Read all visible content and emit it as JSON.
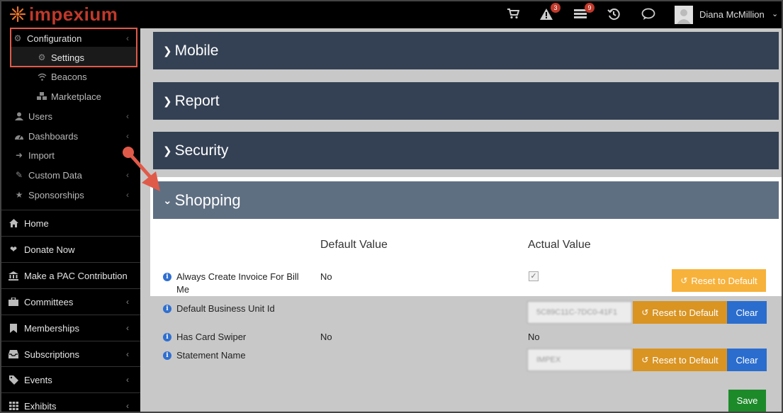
{
  "app": {
    "logo_text": "impexium",
    "brand_color": "#c0392b"
  },
  "topbar": {
    "cart_icon": "cart-icon",
    "alerts_badge": "3",
    "tasks_badge": "9",
    "history_icon": "history-icon",
    "chat_icon": "chat-icon",
    "user_name": "Diana McMillion"
  },
  "sidebar": {
    "configuration": "Configuration",
    "settings": "Settings",
    "beacons": "Beacons",
    "marketplace": "Marketplace",
    "users": "Users",
    "dashboards": "Dashboards",
    "import": "Import",
    "custom_data": "Custom Data",
    "sponsorships": "Sponsorships",
    "main": [
      {
        "label": "Home",
        "icon": "home-icon"
      },
      {
        "label": "Donate Now",
        "icon": "heart-icon"
      },
      {
        "label": "Make a PAC Contribution",
        "icon": "bank-icon"
      },
      {
        "label": "Committees",
        "icon": "briefcase-icon"
      },
      {
        "label": "Memberships",
        "icon": "bookmark-icon"
      },
      {
        "label": "Subscriptions",
        "icon": "inbox-icon"
      },
      {
        "label": "Events",
        "icon": "tag-icon"
      },
      {
        "label": "Exhibits",
        "icon": "grid-icon"
      }
    ]
  },
  "panels": {
    "mobile": "Mobile",
    "report": "Report",
    "security": "Security",
    "shopping": "Shopping"
  },
  "shopping": {
    "col_default": "Default Value",
    "col_actual": "Actual Value",
    "rows": [
      {
        "label": "Always Create Invoice For Bill Me",
        "default": "No",
        "actual_checked": true,
        "reset": "Reset to Default"
      },
      {
        "label": "Default Business Unit Id",
        "default": "",
        "actual_value": "5C89C11C-7DC0-41F1",
        "reset": "Reset to Default",
        "clear": "Clear"
      },
      {
        "label": "Has Card Swiper",
        "default": "No",
        "actual": "No"
      },
      {
        "label": "Statement Name",
        "default": "",
        "actual_value": "IMPEX",
        "reset": "Reset to Default",
        "clear": "Clear"
      }
    ],
    "save": "Save"
  },
  "colors": {
    "panel_dark": "#344154",
    "panel_active": "#5f6f82",
    "reset_light": "#f7b23b",
    "reset_dark": "#d99422",
    "clear": "#2a6dcf",
    "save": "#1d8a2a",
    "annotation": "#e05a4a"
  }
}
